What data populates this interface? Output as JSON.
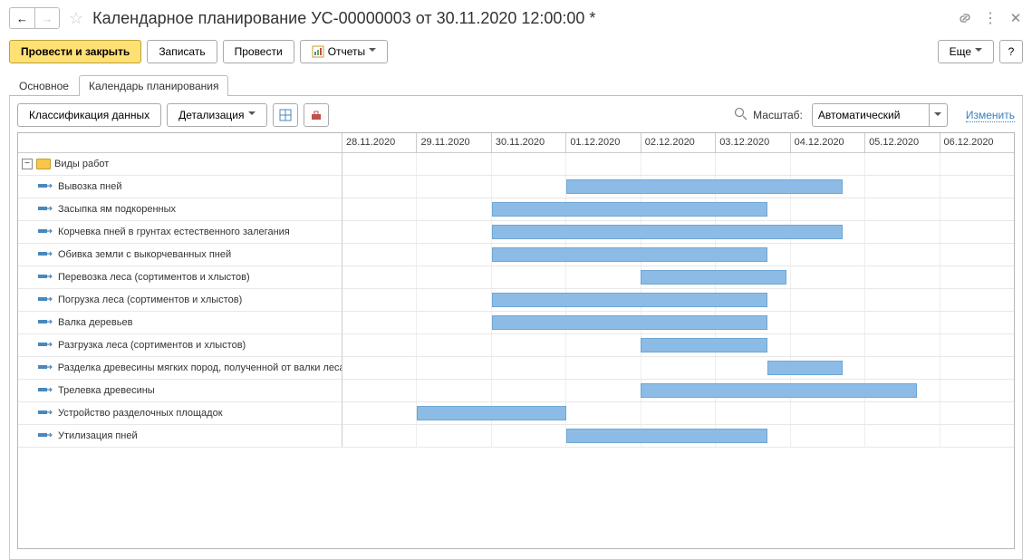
{
  "header": {
    "title": "Календарное планирование УС-00000003 от 30.11.2020 12:00:00 *"
  },
  "commands": {
    "post_close": "Провести и закрыть",
    "write": "Записать",
    "post": "Провести",
    "reports": "Отчеты",
    "more": "Еще"
  },
  "tabs": {
    "main": "Основное",
    "calendar": "Календарь планирования"
  },
  "toolbar": {
    "classify": "Классификация данных",
    "detail": "Детализация",
    "scale_label": "Масштаб:",
    "scale_value": "Автоматический",
    "change": "Изменить"
  },
  "dates": [
    "28.11.2020",
    "29.11.2020",
    "30.11.2020",
    "01.12.2020",
    "02.12.2020",
    "03.12.2020",
    "04.12.2020",
    "05.12.2020",
    "06.12.2020"
  ],
  "group_label": "Виды работ",
  "tasks": [
    {
      "label": "Вывозка пней",
      "start": 3,
      "end": 6.7
    },
    {
      "label": "Засыпка ям подкоренных",
      "start": 2,
      "end": 5.7
    },
    {
      "label": "Корчевка пней в грунтах естественного залегания",
      "start": 2,
      "end": 6.7
    },
    {
      "label": "Обивка земли с выкорчеванных пней",
      "start": 2,
      "end": 5.7
    },
    {
      "label": "Перевозка леса (сортиментов и хлыстов)",
      "start": 4,
      "end": 5.95
    },
    {
      "label": "Погрузка леса (сортиментов и хлыстов)",
      "start": 2,
      "end": 5.7
    },
    {
      "label": "Валка деревьев",
      "start": 2,
      "end": 5.7
    },
    {
      "label": "Разгрузка леса (сортиментов и хлыстов)",
      "start": 4,
      "end": 5.7
    },
    {
      "label": "Разделка древесины мягких пород, полученной от валки леса",
      "start": 5.7,
      "end": 6.7
    },
    {
      "label": "Трелевка древесины",
      "start": 4,
      "end": 7.7
    },
    {
      "label": "Устройство разделочных площадок",
      "start": 1,
      "end": 3
    },
    {
      "label": "Утилизация пней",
      "start": 3,
      "end": 5.7
    }
  ],
  "chart_data": {
    "type": "gantt",
    "x_axis": {
      "type": "date",
      "start": "2020-11-28",
      "end": "2020-12-06",
      "unit": "day"
    },
    "categories": [
      "28.11.2020",
      "29.11.2020",
      "30.11.2020",
      "01.12.2020",
      "02.12.2020",
      "03.12.2020",
      "04.12.2020",
      "05.12.2020",
      "06.12.2020"
    ],
    "series": [
      {
        "name": "Вывозка пней",
        "start": "2020-12-01",
        "end": "2020-12-04"
      },
      {
        "name": "Засыпка ям подкоренных",
        "start": "2020-11-30",
        "end": "2020-12-03"
      },
      {
        "name": "Корчевка пней в грунтах естественного залегания",
        "start": "2020-11-30",
        "end": "2020-12-04"
      },
      {
        "name": "Обивка земли с выкорчеванных пней",
        "start": "2020-11-30",
        "end": "2020-12-03"
      },
      {
        "name": "Перевозка леса (сортиментов и хлыстов)",
        "start": "2020-12-02",
        "end": "2020-12-04"
      },
      {
        "name": "Погрузка леса (сортиментов и хлыстов)",
        "start": "2020-11-30",
        "end": "2020-12-03"
      },
      {
        "name": "Валка деревьев",
        "start": "2020-11-30",
        "end": "2020-12-03"
      },
      {
        "name": "Разгрузка леса (сортиментов и хлыстов)",
        "start": "2020-12-02",
        "end": "2020-12-03"
      },
      {
        "name": "Разделка древесины мягких пород, полученной от валки леса",
        "start": "2020-12-03",
        "end": "2020-12-04"
      },
      {
        "name": "Трелевка древесины",
        "start": "2020-12-02",
        "end": "2020-12-05"
      },
      {
        "name": "Устройство разделочных площадок",
        "start": "2020-11-29",
        "end": "2020-12-01"
      },
      {
        "name": "Утилизация пней",
        "start": "2020-12-01",
        "end": "2020-12-03"
      }
    ]
  }
}
